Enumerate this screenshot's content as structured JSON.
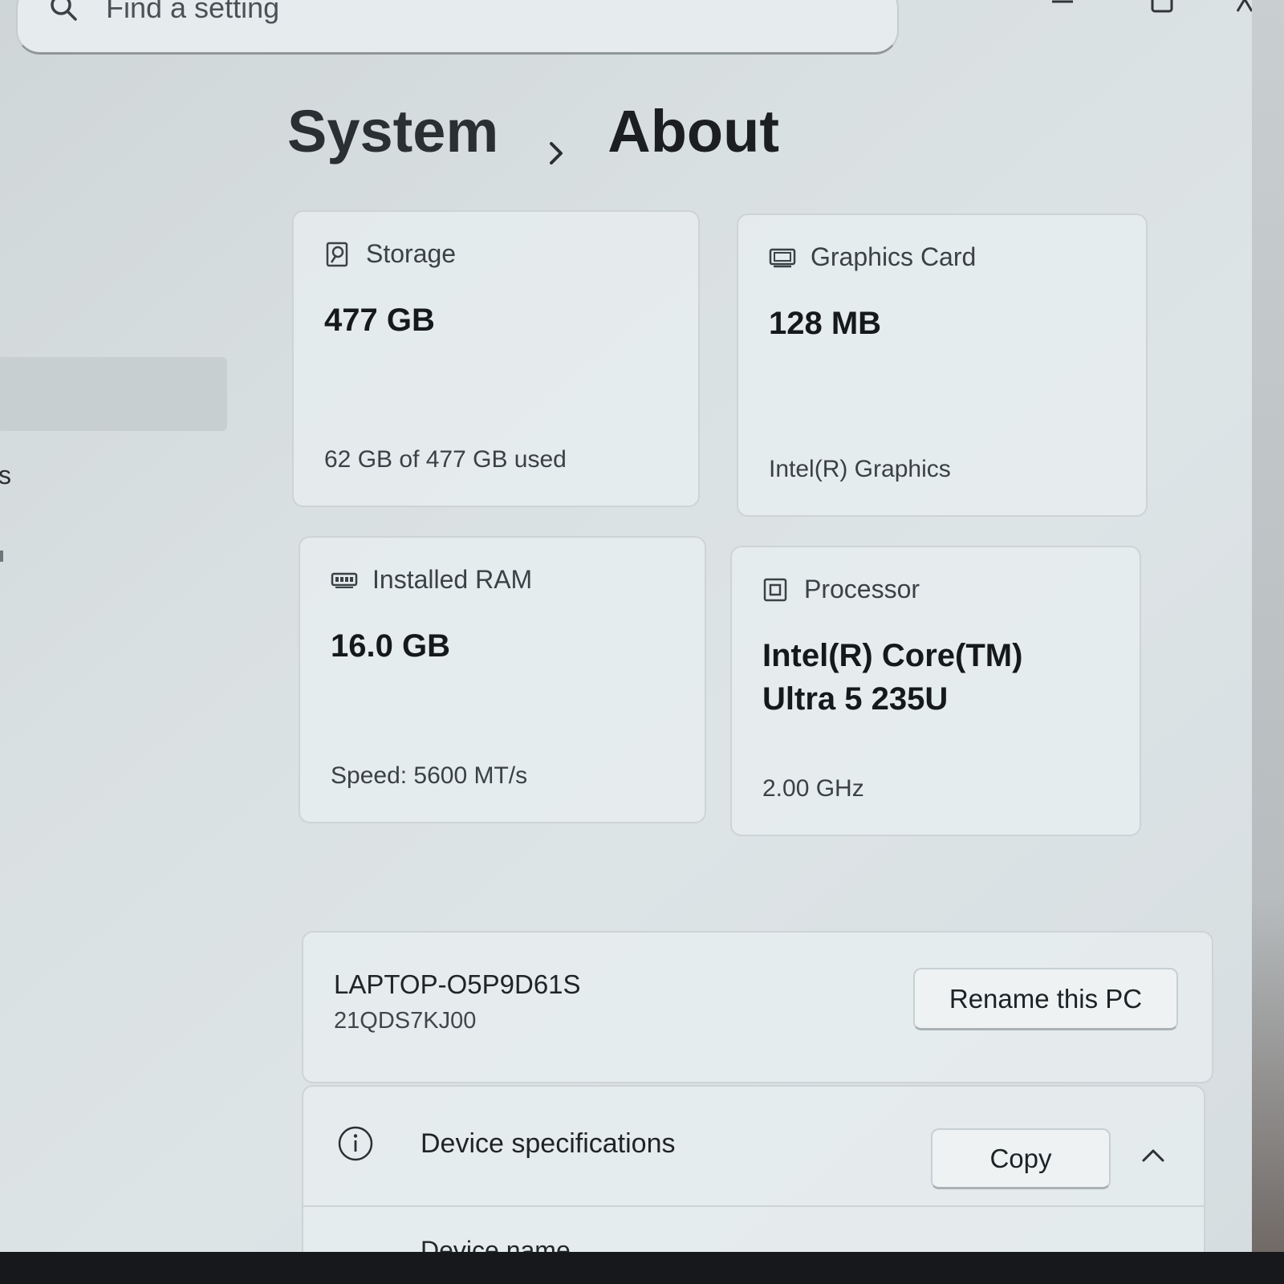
{
  "search": {
    "placeholder": "Find a setting",
    "icon": "search-icon"
  },
  "window_controls": {
    "minimize_icon": "minimize-icon",
    "maximize_icon": "maximize-icon",
    "close_icon": "close-icon"
  },
  "nav": {
    "partial_label": "s"
  },
  "breadcrumb": {
    "parent": "System",
    "separator_icon": "chevron-right-icon",
    "current": "About"
  },
  "specs_cards": {
    "storage": {
      "label": "Storage",
      "icon": "storage-drive-icon",
      "value": "477 GB",
      "sub": "62 GB of 477 GB used"
    },
    "graphics": {
      "label": "Graphics Card",
      "icon": "graphics-card-icon",
      "value": "128 MB",
      "sub": "Intel(R) Graphics"
    },
    "ram": {
      "label": "Installed RAM",
      "icon": "ram-module-icon",
      "value": "16.0 GB",
      "sub": "Speed: 5600 MT/s"
    },
    "processor": {
      "label": "Processor",
      "icon": "processor-chip-icon",
      "value_line1": "Intel(R) Core(TM)",
      "value_line2": "Ultra 5 235U",
      "sub": "2.00 GHz"
    }
  },
  "pc": {
    "name": "LAPTOP-O5P9D61S",
    "model": "21QDS7KJ00",
    "rename_label": "Rename this PC"
  },
  "device_specs": {
    "title": "Device specifications",
    "icon": "info-icon",
    "copy_label": "Copy",
    "expand_icon": "chevron-up-icon",
    "rows": [
      {
        "label": "Device name"
      }
    ]
  },
  "colors": {
    "background": "#d9e0e2",
    "card": "#e8eef0",
    "card_border": "#cdd4d6",
    "text_primary": "#15191c",
    "text_secondary": "#3a4145"
  }
}
